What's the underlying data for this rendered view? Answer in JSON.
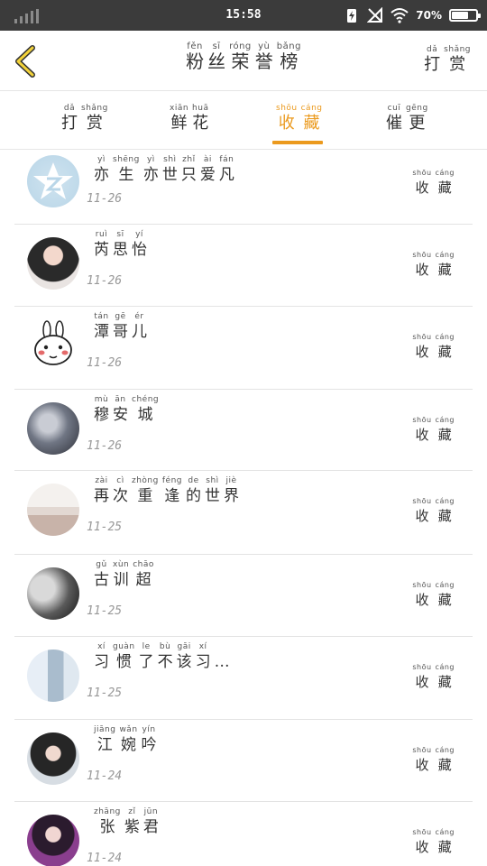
{
  "status_bar": {
    "time": "15:58",
    "battery_percent": "70%",
    "battery_level": 0.7
  },
  "header": {
    "back_icon": "chevron-left-icon",
    "title": [
      {
        "pinyin": "fěn",
        "char": "粉"
      },
      {
        "pinyin": "sī",
        "char": "丝"
      },
      {
        "pinyin": "róng",
        "char": "荣"
      },
      {
        "pinyin": "yù",
        "char": "誉"
      },
      {
        "pinyin": "bǎng",
        "char": "榜"
      }
    ],
    "right_action": [
      {
        "pinyin": "dǎ",
        "char": "打"
      },
      {
        "pinyin": "shǎng",
        "char": "赏"
      }
    ]
  },
  "tabs": [
    {
      "chars": [
        {
          "pinyin": "dǎ",
          "char": "打"
        },
        {
          "pinyin": "shǎng",
          "char": "赏"
        }
      ],
      "active": false
    },
    {
      "chars": [
        {
          "pinyin": "xiān",
          "char": "鲜"
        },
        {
          "pinyin": "huā",
          "char": "花"
        }
      ],
      "active": false
    },
    {
      "chars": [
        {
          "pinyin": "shōu",
          "char": "收"
        },
        {
          "pinyin": "cáng",
          "char": "藏"
        }
      ],
      "active": true
    },
    {
      "chars": [
        {
          "pinyin": "cuī",
          "char": "催"
        },
        {
          "pinyin": "gēng",
          "char": "更"
        }
      ],
      "active": false
    }
  ],
  "accent_color": "#eb9a1e",
  "row_action": [
    {
      "pinyin": "shōu",
      "char": "收"
    },
    {
      "pinyin": "cáng",
      "char": "藏"
    }
  ],
  "rows": [
    {
      "name": [
        {
          "pinyin": "yì",
          "char": "亦"
        },
        {
          "pinyin": "shēng",
          "char": "生"
        },
        {
          "pinyin": "yì",
          "char": "亦"
        },
        {
          "pinyin": "shì",
          "char": "世"
        },
        {
          "pinyin": "zhǐ",
          "char": "只"
        },
        {
          "pinyin": "ài",
          "char": "爱"
        },
        {
          "pinyin": "fán",
          "char": "凡"
        }
      ],
      "date": "11-26",
      "avatar": "star-logo"
    },
    {
      "name": [
        {
          "pinyin": "ruì",
          "char": "芮"
        },
        {
          "pinyin": "sī",
          "char": "思"
        },
        {
          "pinyin": "yí",
          "char": "怡"
        }
      ],
      "date": "11-26",
      "avatar": "photo"
    },
    {
      "name": [
        {
          "pinyin": "tán",
          "char": "潭"
        },
        {
          "pinyin": "gē",
          "char": "哥"
        },
        {
          "pinyin": "ér",
          "char": "儿"
        }
      ],
      "date": "11-26",
      "avatar": "rabbit"
    },
    {
      "name": [
        {
          "pinyin": "mù",
          "char": "穆"
        },
        {
          "pinyin": "ān",
          "char": "安"
        },
        {
          "pinyin": "chéng",
          "char": "城"
        }
      ],
      "date": "11-26",
      "avatar": "photo"
    },
    {
      "name": [
        {
          "pinyin": "zài",
          "char": "再"
        },
        {
          "pinyin": "cì",
          "char": "次"
        },
        {
          "pinyin": "zhòng",
          "char": "重"
        },
        {
          "pinyin": "féng",
          "char": "逢"
        },
        {
          "pinyin": "de",
          "char": "的"
        },
        {
          "pinyin": "shì",
          "char": "世"
        },
        {
          "pinyin": "jiè",
          "char": "界"
        }
      ],
      "date": "11-25",
      "avatar": "photo"
    },
    {
      "name": [
        {
          "pinyin": "gǔ",
          "char": "古"
        },
        {
          "pinyin": "xùn",
          "char": "训"
        },
        {
          "pinyin": "chāo",
          "char": "超"
        }
      ],
      "date": "11-25",
      "avatar": "photo"
    },
    {
      "name": [
        {
          "pinyin": "xí",
          "char": "习"
        },
        {
          "pinyin": "guàn",
          "char": "惯"
        },
        {
          "pinyin": "le",
          "char": "了"
        },
        {
          "pinyin": "bù",
          "char": "不"
        },
        {
          "pinyin": "gāi",
          "char": "该"
        },
        {
          "pinyin": "xí",
          "char": "习"
        }
      ],
      "ellipsis": "…",
      "date": "11-25",
      "avatar": "photo"
    },
    {
      "name": [
        {
          "pinyin": "jiāng",
          "char": "江"
        },
        {
          "pinyin": "wǎn",
          "char": "婉"
        },
        {
          "pinyin": "yín",
          "char": "吟"
        }
      ],
      "date": "11-24",
      "avatar": "photo"
    },
    {
      "name": [
        {
          "pinyin": "zhāng",
          "char": "张"
        },
        {
          "pinyin": "zǐ",
          "char": "紫"
        },
        {
          "pinyin": "jūn",
          "char": "君"
        }
      ],
      "date": "11-24",
      "avatar": "photo"
    }
  ]
}
